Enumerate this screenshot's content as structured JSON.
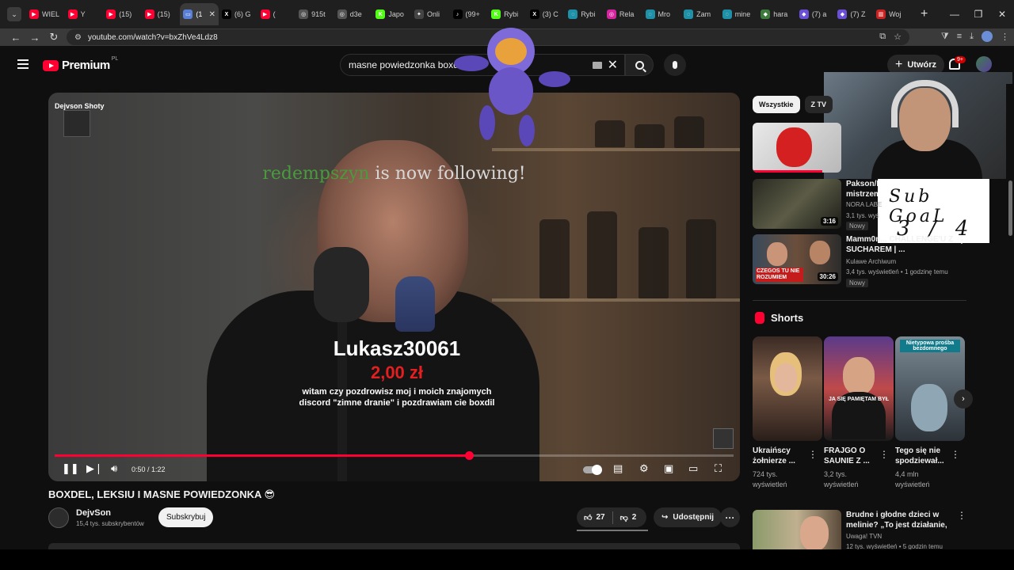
{
  "browser": {
    "tabs": [
      {
        "label": "WIEL",
        "fav_color": "#ff0033",
        "fav_glyph": "▶"
      },
      {
        "label": "Y",
        "fav_color": "#ff0033",
        "fav_glyph": "▶"
      },
      {
        "label": "(15)",
        "fav_color": "#ff0033",
        "fav_glyph": "▶"
      },
      {
        "label": "(15)",
        "fav_color": "#ff0033",
        "fav_glyph": "▶"
      },
      {
        "label": "(1",
        "fav_color": "#5a7fd6",
        "fav_glyph": "▭",
        "active": true
      },
      {
        "label": "(6) G",
        "fav_color": "#000000",
        "fav_glyph": "X"
      },
      {
        "label": "(",
        "fav_color": "#ff0033",
        "fav_glyph": "▶"
      },
      {
        "label": "915t",
        "fav_color": "#555555",
        "fav_glyph": "◎"
      },
      {
        "label": "d3e",
        "fav_color": "#555555",
        "fav_glyph": "◎"
      },
      {
        "label": "Japo",
        "fav_color": "#53fc18",
        "fav_glyph": "K"
      },
      {
        "label": "Onli",
        "fav_color": "#444444",
        "fav_glyph": "✦"
      },
      {
        "label": "(99+",
        "fav_color": "#000000",
        "fav_glyph": "♪"
      },
      {
        "label": "Rybi",
        "fav_color": "#53fc18",
        "fav_glyph": "K"
      },
      {
        "label": "(3) C",
        "fav_color": "#000000",
        "fav_glyph": "X"
      },
      {
        "label": "Rybi",
        "fav_color": "#1e90a8",
        "fav_glyph": "◌"
      },
      {
        "label": "Rela",
        "fav_color": "#d6249f",
        "fav_glyph": "◎"
      },
      {
        "label": "Mro",
        "fav_color": "#1e90a8",
        "fav_glyph": "◌"
      },
      {
        "label": "Zam",
        "fav_color": "#1e90a8",
        "fav_glyph": "◌"
      },
      {
        "label": "mine",
        "fav_color": "#1e90a8",
        "fav_glyph": "◌"
      },
      {
        "label": "hara",
        "fav_color": "#3e7a3e",
        "fav_glyph": "◆"
      },
      {
        "label": "(7) a",
        "fav_color": "#6b4fd6",
        "fav_glyph": "◆"
      },
      {
        "label": "(7) Z",
        "fav_color": "#6b4fd6",
        "fav_glyph": "◆"
      },
      {
        "label": "Woj",
        "fav_color": "#cc2222",
        "fav_glyph": "▥"
      }
    ],
    "url": "youtube.com/watch?v=bxZhVe4Ldz8"
  },
  "masthead": {
    "brand": "Premium",
    "region": "PL",
    "search_query": "masne powiedzonka boxdel",
    "create_label": "Utwórz",
    "notification_count": "9+"
  },
  "player": {
    "watermark_label": "Dejvson Shoty",
    "follow_name": "redempszyn",
    "follow_text": " is now following!",
    "donation_name": "Lukasz30061",
    "donation_amount": "2,00 zł",
    "donation_message": "witam czy pozdrowisz moj i moich znajomych discord \"zimne dranie\" i pozdrawiam cie boxdil",
    "time_current": "0:50",
    "time_total": "1:22",
    "time_display": "0:50 / 1:22",
    "progress_fraction": 0.61,
    "accent": "#ff0033"
  },
  "overlay": {
    "subgoal_line1": "Sub GoaL",
    "subgoal_line2": "3 / 4"
  },
  "video": {
    "title": "BOXDEL, LEKSIU I MASNE POWIEDZONKA 😎",
    "channel_name": "DejvSon",
    "channel_subs": "15,4 tys. subskrybentów",
    "subscribe_label": "Subskrybuj",
    "likes": "27",
    "dislikes": "2",
    "share_label": "Udostępnij"
  },
  "sidebar": {
    "chips": [
      "Wszystkie",
      "Z TV"
    ],
    "recommendations": [
      {
        "title": "",
        "channel": "",
        "meta": "",
        "duration": "",
        "badge": "",
        "thumb": "red"
      },
      {
        "title": "Pakson/D... mistrzem",
        "channel": "NORA LABE",
        "meta": "3,1 tys. wyś",
        "duration": "3:16",
        "badge": "Nowy",
        "thumb": "dark"
      },
      {
        "title": "Mamm0n... CHALLENGE'U Z SUCHAREM | ...",
        "channel": "Kulawe Archiwum",
        "meta": "3,4 tys. wyświetleń • 1 godzinę temu",
        "duration": "30:26",
        "badge": "Nowy",
        "thumb": "podcast",
        "thumb_caption": "CZEGOS TU NIE ROZUMIEM"
      },
      {
        "title": "Brudne i głodne dzieci w melinie? „To jest działanie, żeb...",
        "channel": "Uwaga! TVN",
        "meta": "12 tys. wyświetleń • 5 godzin temu",
        "duration": "",
        "badge": "",
        "thumb": "news"
      }
    ],
    "shorts_label": "Shorts",
    "shorts": [
      {
        "title": "Ukraińscy żołnierze ...",
        "views": "724 tys. wyświetleń",
        "caption": "",
        "thumb": "blonde"
      },
      {
        "title": "FRAJGO O SAUNIE Z ...",
        "views": "3,2 tys. wyświetleń",
        "caption": "JA SIĘ PAMIĘTAM BYŁ",
        "thumb": "boy"
      },
      {
        "title": "Tego się nie spodziewał...",
        "views": "4,4 mln wyświetleń",
        "caption": "Nietypowa prośba bezdomnego",
        "thumb": "street"
      }
    ]
  }
}
